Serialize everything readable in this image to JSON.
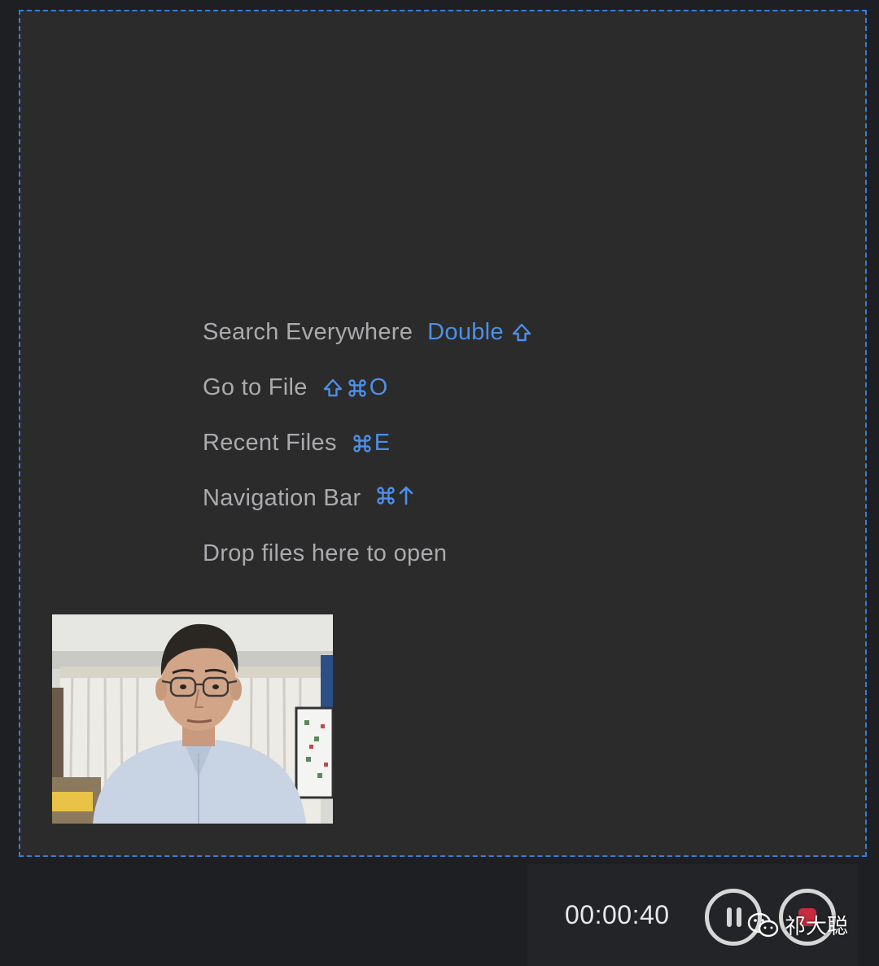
{
  "editor": {
    "hints": [
      {
        "label": "Search Everywhere",
        "shortcut_text": "Double",
        "shortcut_icons": [
          "shift-icon"
        ]
      },
      {
        "label": "Go to File",
        "shortcut_icons": [
          "shift-icon",
          "command-icon"
        ],
        "shortcut_text": "O"
      },
      {
        "label": "Recent Files",
        "shortcut_icons": [
          "command-icon"
        ],
        "shortcut_text": "E"
      },
      {
        "label": "Navigation Bar",
        "shortcut_icons": [
          "command-icon",
          "arrow-up-icon"
        ]
      },
      {
        "label": "Drop files here to open"
      }
    ]
  },
  "webcam": {
    "icon": "webcam-preview"
  },
  "recorder": {
    "elapsed": "00:00:40",
    "pause_icon": "pause-icon",
    "stop_icon": "stop-icon",
    "stop_color": "#c72b3e"
  },
  "watermark": {
    "text": "祁大聪",
    "icon": "wechat-icon"
  },
  "colors": {
    "background": "#1e1f22",
    "editor_background": "#2b2b2b",
    "hint_text": "#a9abae",
    "shortcut_accent": "#4d8fe6",
    "drop_border": "#3d7bd6"
  }
}
